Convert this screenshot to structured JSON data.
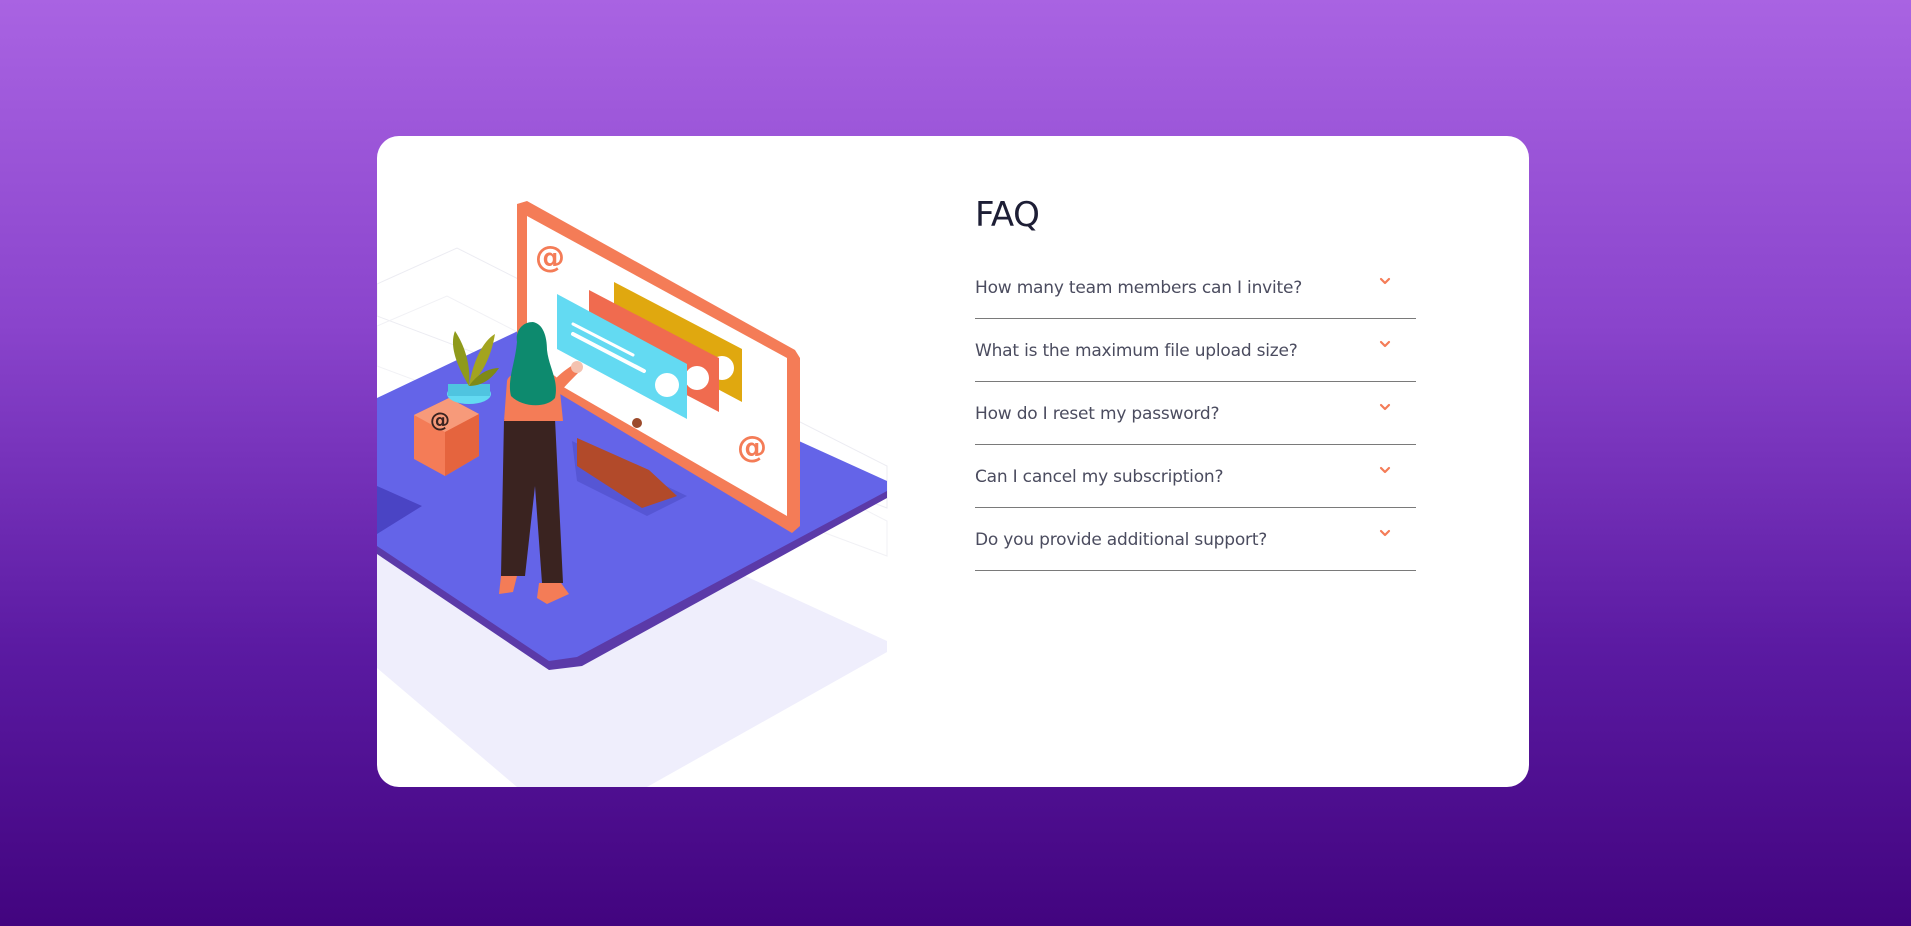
{
  "faq": {
    "title": "FAQ",
    "items": [
      {
        "question": "How many team members can I invite?"
      },
      {
        "question": "What is the maximum file upload size?"
      },
      {
        "question": "How do I reset my password?"
      },
      {
        "question": "Can I cancel my subscription?"
      },
      {
        "question": "Do you provide additional support?"
      }
    ]
  },
  "colors": {
    "background_top": "#a963e2",
    "background_bottom": "#42047f",
    "card": "#ffffff",
    "accent": "#f47c57",
    "title": "#1d1e35",
    "question": "#4b4c5f",
    "divider": "#7a7a7a"
  },
  "icons": {
    "chevron": "chevron-down-icon",
    "illustration": "woman-at-monitor-illustration"
  }
}
